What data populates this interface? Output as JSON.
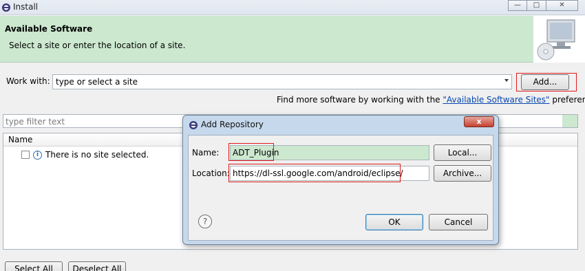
{
  "window": {
    "title": "Install",
    "minimize_icon": "—",
    "maximize_icon": "□",
    "close_icon": "✕"
  },
  "banner": {
    "heading": "Available Software",
    "description": "Select a site or enter the location of a site."
  },
  "work_with": {
    "label": "Work with:",
    "value": "type or select a site",
    "add_button": "Add...",
    "find_more_prefix": "Find more software by working with the ",
    "find_more_link": "\"Available Software Sites\"",
    "find_more_suffix": " preferences."
  },
  "filter": {
    "placeholder": "type filter text"
  },
  "list": {
    "column_name": "Name",
    "empty_message": "There is no site selected."
  },
  "buttons": {
    "select_all": "Select All",
    "deselect_all": "Deselect All"
  },
  "dialog": {
    "title": "Add Repository",
    "close_icon": "x",
    "name_label": "Name:",
    "name_value": "ADT_Plugin",
    "local_button": "Local...",
    "location_label": "Location:",
    "location_value": "https://dl-ssl.google.com/android/eclipse/",
    "archive_button": "Archive...",
    "help_icon": "?",
    "ok_button": "OK",
    "cancel_button": "Cancel"
  },
  "colors": {
    "banner": "#cce8cf",
    "highlight": "#e01818",
    "link": "#0645ad"
  }
}
